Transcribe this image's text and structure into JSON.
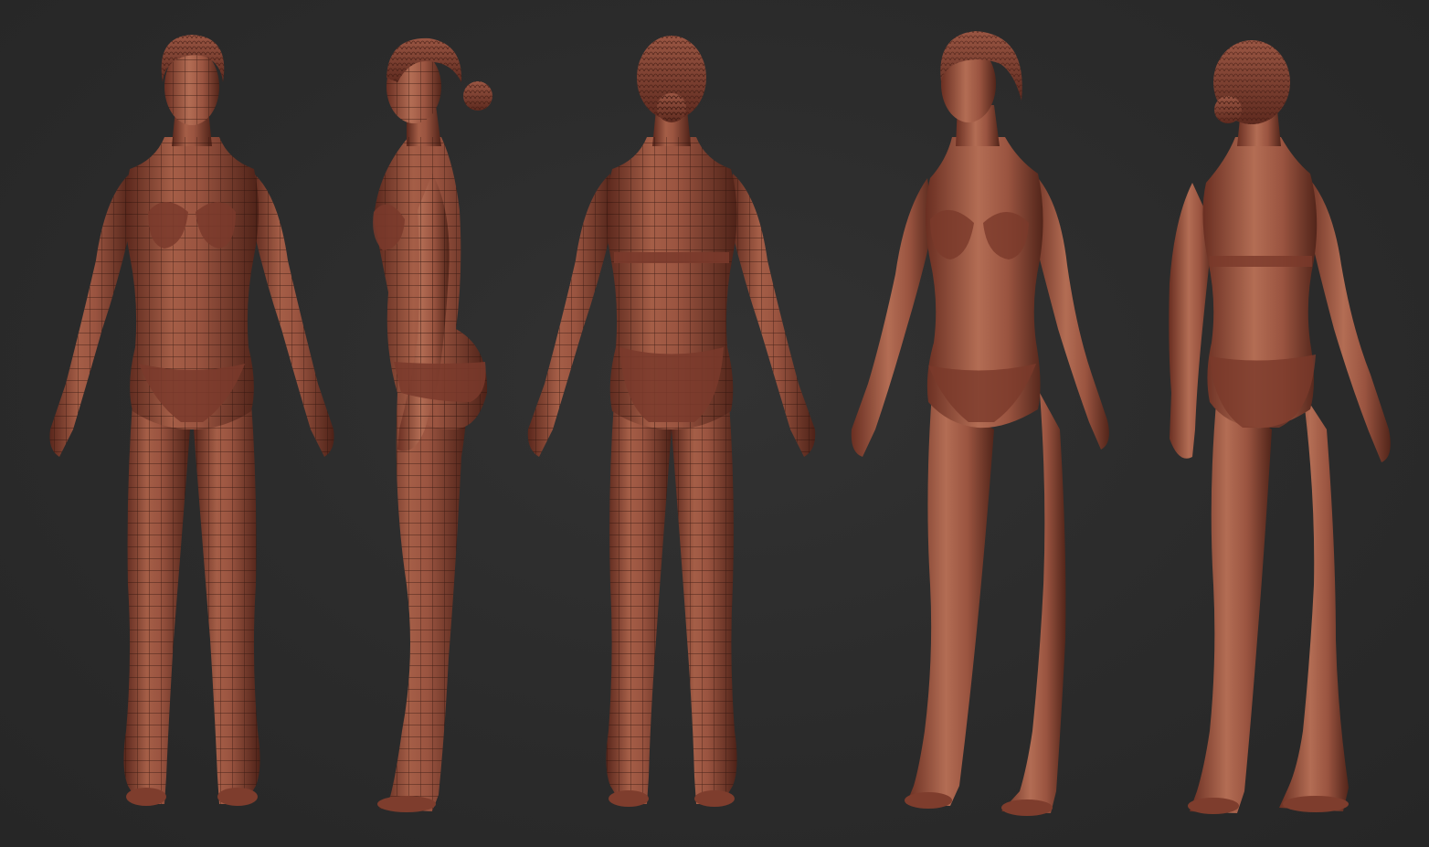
{
  "scene": {
    "background_color": "#2b2b2b",
    "clay_color": "#8e4a38",
    "clay_highlight": "#b06a52",
    "clay_shadow": "#4e2218",
    "wire_color": "#2a120c"
  },
  "figures": [
    {
      "id": "front-wireframe",
      "view": "front",
      "wireframe": true
    },
    {
      "id": "side-wireframe",
      "view": "side",
      "wireframe": true
    },
    {
      "id": "back-wireframe",
      "view": "back",
      "wireframe": true
    },
    {
      "id": "three-quarter-front",
      "view": "three-quarter-front",
      "wireframe": false
    },
    {
      "id": "three-quarter-back",
      "view": "three-quarter-back",
      "wireframe": false
    }
  ]
}
